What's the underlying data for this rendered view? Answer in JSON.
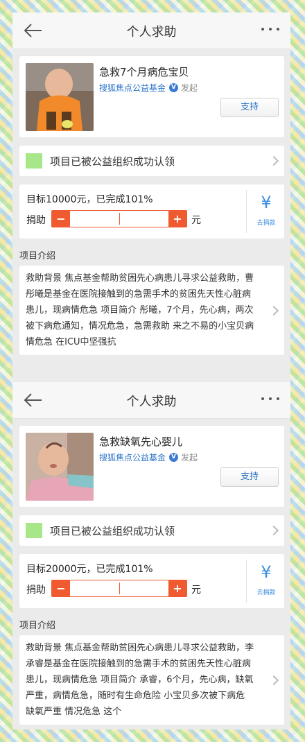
{
  "screens": [
    {
      "nav": {
        "title": "个人求助"
      },
      "project": {
        "title": "急救7个月病危宝贝",
        "org": "搜狐焦点公益基金",
        "verified": "V",
        "initiated": "发起",
        "support_label": "支持",
        "photo_icon": "baby-photo-orange"
      },
      "claim": {
        "text": "项目已被公益组织成功认领"
      },
      "goal": {
        "text": "目标10000元，已完成101%",
        "donate_label": "捐助",
        "minus": "−",
        "plus": "+",
        "unit": "元",
        "yen": "¥",
        "go_donate": "去捐款",
        "progress_percent": 101
      },
      "intro": {
        "label": "项目介绍",
        "body": "救助背景 焦点基金帮助贫困先心病患儿寻求公益救助，曹彤曦是基金在医院接触到的急需手术的贫困先天性心脏病患儿，现病情危急 项目简介 彤曦，7个月，先心病，两次被下病危通知，情况危急，急需救助 来之不易的小宝贝病情危急 在ICU中坚强抗"
      }
    },
    {
      "nav": {
        "title": "个人求助"
      },
      "project": {
        "title": "急救缺氧先心婴儿",
        "org": "搜狐焦点公益基金",
        "verified": "V",
        "initiated": "发起",
        "support_label": "支持",
        "photo_icon": "baby-photo-pink"
      },
      "claim": {
        "text": "项目已被公益组织成功认领"
      },
      "goal": {
        "text": "目标20000元，已完成101%",
        "donate_label": "捐助",
        "minus": "−",
        "plus": "+",
        "unit": "元",
        "yen": "¥",
        "go_donate": "去捐款",
        "progress_percent": 101
      },
      "intro": {
        "label": "项目介绍",
        "body": "救助背景 焦点基金帮助贫困先心病患儿寻求公益救助，李承睿是基金在医院接触到的急需手术的贫困先天性心脏病患儿，现病情危急 项目简介 承睿，6个月，先心病，缺氧严重，病情危急，随时有生命危险 小宝贝多次被下病危 缺氧严重 情况危急 这个"
      }
    }
  ],
  "colors": {
    "accent": "#f05a30",
    "link": "#2a73c9",
    "claim_square": "#a8e68a",
    "donate_blue": "#3b8ee0"
  }
}
